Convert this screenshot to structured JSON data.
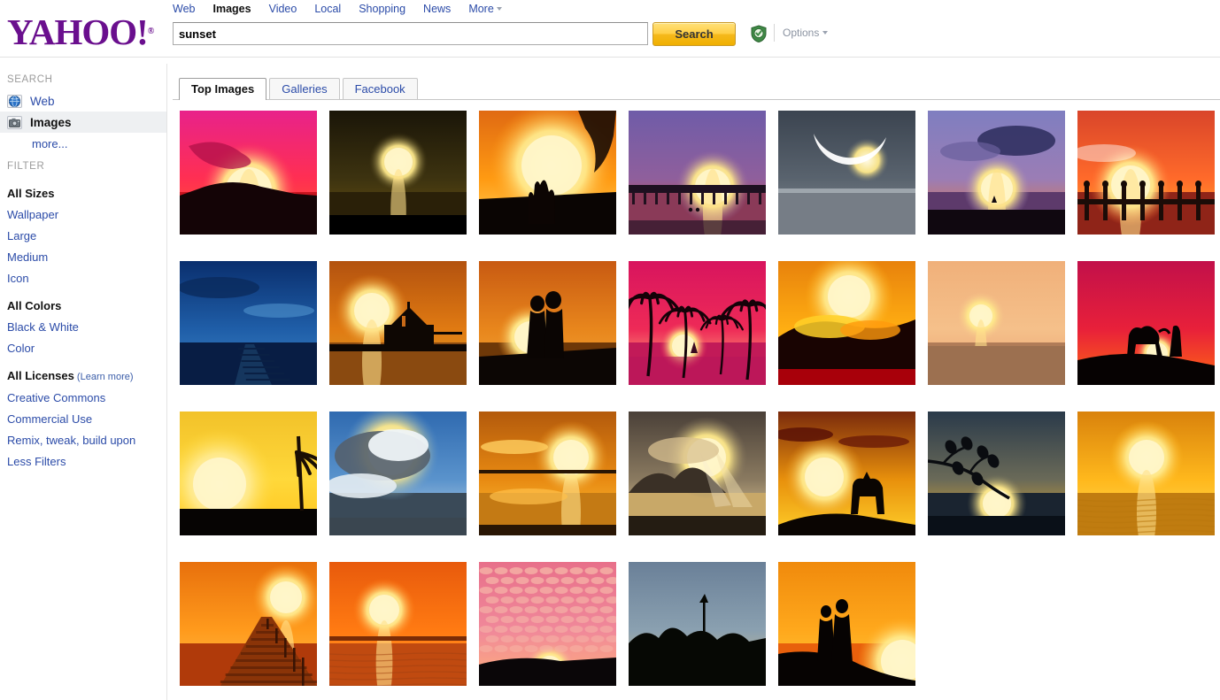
{
  "brand": {
    "logo_text": "YAHOO!",
    "registered": "®"
  },
  "topnav": {
    "items": [
      {
        "label": "Web",
        "active": false
      },
      {
        "label": "Images",
        "active": true
      },
      {
        "label": "Video",
        "active": false
      },
      {
        "label": "Local",
        "active": false
      },
      {
        "label": "Shopping",
        "active": false
      },
      {
        "label": "News",
        "active": false
      },
      {
        "label": "More",
        "active": false
      }
    ]
  },
  "search": {
    "query": "sunset",
    "placeholder": "",
    "button_label": "Search",
    "options_label": "Options",
    "shield_icon": "shield-check-icon",
    "button_color": "#f5b91c"
  },
  "sidebar": {
    "search_heading": "SEARCH",
    "search_items": [
      {
        "label": "Web",
        "icon": "globe-icon",
        "selected": false
      },
      {
        "label": "Images",
        "icon": "camera-icon",
        "selected": true
      }
    ],
    "more_label": "more...",
    "filter_heading": "FILTER",
    "filters": [
      {
        "label": "All Sizes",
        "bold": true
      },
      {
        "label": "Wallpaper",
        "bold": false
      },
      {
        "label": "Large",
        "bold": false
      },
      {
        "label": "Medium",
        "bold": false
      },
      {
        "label": "Icon",
        "bold": false
      },
      {
        "label": "All Colors",
        "bold": true
      },
      {
        "label": "Black & White",
        "bold": false
      },
      {
        "label": "Color",
        "bold": false
      },
      {
        "label": "All Licenses",
        "bold": true,
        "extra": "(Learn more)"
      },
      {
        "label": "Creative Commons",
        "bold": false
      },
      {
        "label": "Commercial Use",
        "bold": false
      },
      {
        "label": "Remix, tweak, build upon",
        "bold": false
      },
      {
        "label": "Less Filters",
        "bold": false
      }
    ]
  },
  "tabs": [
    {
      "label": "Top Images",
      "active": true
    },
    {
      "label": "Galleries",
      "active": false
    },
    {
      "label": "Facebook",
      "active": false
    }
  ],
  "results": {
    "count": 28,
    "thumbnails": [
      {
        "name": "pink-sky-hill-lake-sunset",
        "sky_top": "#e8228a",
        "sky_mid": "#ff2f52",
        "sky_low": "#ff5a2a",
        "water": "#c8141f",
        "land": "#140406",
        "style": "hill"
      },
      {
        "name": "dark-moon-over-sea",
        "sky_top": "#1a1508",
        "sky_mid": "#3d3310",
        "sky_low": "#6d5510",
        "water": "#2a2008",
        "land": "#000000",
        "style": "moon"
      },
      {
        "name": "orange-sunset-hand-silhouette",
        "sky_top": "#e06a12",
        "sky_mid": "#ff9a12",
        "sky_low": "#ffd35e",
        "water": "#140a02",
        "land": "#0a0503",
        "style": "hand"
      },
      {
        "name": "purple-pier-beach-sunset",
        "sky_top": "#6f5ca8",
        "sky_mid": "#8f5f9c",
        "sky_low": "#e8452c",
        "water": "#8a3a58",
        "land": "#241327",
        "style": "pier"
      },
      {
        "name": "crescent-moon-over-water",
        "sky_top": "#3b4450",
        "sky_mid": "#59636e",
        "sky_low": "#8a9099",
        "water": "#767d86",
        "land": "#9aa0a6",
        "style": "crescent"
      },
      {
        "name": "purple-clouds-beach-bird",
        "sky_top": "#7f7ec0",
        "sky_mid": "#9b7db5",
        "sky_low": "#f0732a",
        "water": "#5d3a6b",
        "land": "#100810",
        "style": "clouds"
      },
      {
        "name": "red-sky-dock-birds",
        "sky_top": "#d9452a",
        "sky_mid": "#ff6a2a",
        "sky_low": "#ffb32a",
        "water": "#8f2418",
        "land": "#1a0a08",
        "style": "dock"
      },
      {
        "name": "blue-night-boardwalk",
        "sky_top": "#0a2f6e",
        "sky_mid": "#1f5ea8",
        "sky_low": "#3f86c8",
        "water": "#081d44",
        "land": "#03102a",
        "style": "boardwalk"
      },
      {
        "name": "gazebo-pier-orange-sun",
        "sky_top": "#b3520f",
        "sky_mid": "#e07a12",
        "sky_low": "#d9a02a",
        "water": "#8a4a10",
        "land": "#120804",
        "style": "gazebo"
      },
      {
        "name": "couple-embracing-silhouette",
        "sky_top": "#c85a12",
        "sky_mid": "#e8861c",
        "sky_low": "#f2a83a",
        "water": "#6e3808",
        "land": "#0c0604",
        "style": "couple"
      },
      {
        "name": "palm-trees-magenta-sunset",
        "sky_top": "#d8145e",
        "sky_mid": "#ee2a57",
        "sky_low": "#ffd08a",
        "water": "#c21a58",
        "land": "#6a0a34",
        "style": "palms"
      },
      {
        "name": "fiery-orange-clouds",
        "sky_top": "#e8820c",
        "sky_mid": "#ffae12",
        "sky_low": "#ffd028",
        "water": "#b3000a",
        "land": "#160400",
        "style": "fire"
      },
      {
        "name": "golden-sky-ocean-horizon",
        "sky_top": "#f0b07a",
        "sky_mid": "#f5c08a",
        "sky_low": "#e8a070",
        "water": "#b07c58",
        "land": "#8a6040",
        "style": "softsun"
      },
      {
        "name": "camel-and-person-silhouette",
        "sky_top": "#c2104a",
        "sky_mid": "#e8203a",
        "sky_low": "#ff6a12",
        "water": "#2a0206",
        "land": "#0a0202",
        "style": "camel"
      },
      {
        "name": "big-yellow-sun-palm-leaf",
        "sky_top": "#f2c22a",
        "sky_mid": "#ffd83a",
        "sky_low": "#ffc41c",
        "water": "#0a0604",
        "land": "#060403",
        "style": "bigsun"
      },
      {
        "name": "blue-sky-storm-clouds",
        "sky_top": "#2f6ab0",
        "sky_mid": "#5a93cc",
        "sky_low": "#c8d8e6",
        "water": "#3a4a58",
        "land": "#2a3540",
        "style": "stormy"
      },
      {
        "name": "golden-sun-reflection-sea",
        "sky_top": "#b35a0c",
        "sky_mid": "#e88a12",
        "sky_low": "#ffc83a",
        "water": "#c47a14",
        "land": "#3a1c04",
        "style": "goldref"
      },
      {
        "name": "sun-rays-over-mountain",
        "sky_top": "#4a4038",
        "sky_mid": "#8a7a60",
        "sky_low": "#f0d8a0",
        "water": "#c8a868",
        "land": "#2a2018",
        "style": "rays"
      },
      {
        "name": "wolf-silhouette-on-ridge",
        "sky_top": "#7a2a0c",
        "sky_mid": "#e8900c",
        "sky_low": "#ffcf2a",
        "water": "#c87a0c",
        "land": "#0a0502",
        "style": "wolf"
      },
      {
        "name": "tree-branch-silhouette-sea",
        "sky_top": "#2a3a4a",
        "sky_mid": "#6a6a58",
        "sky_low": "#f0b02a",
        "water": "#1a2430",
        "land": "#080c12",
        "style": "branch"
      },
      {
        "name": "golden-sea-sunset-waves",
        "sky_top": "#d9820c",
        "sky_mid": "#ffb81c",
        "sky_low": "#ffdd5a",
        "water": "#c07c10",
        "land": "#6a3c06",
        "style": "waves"
      },
      {
        "name": "wooden-pier-walkway-sunset",
        "sky_top": "#e8700c",
        "sky_mid": "#ff9a1c",
        "sky_low": "#ffc04a",
        "water": "#b03a0a",
        "land": "#7a2a06",
        "style": "walkway"
      },
      {
        "name": "orange-sun-over-calm-sea",
        "sky_top": "#e85a0c",
        "sky_mid": "#ff7a12",
        "sky_low": "#ff9a28",
        "water": "#c04a10",
        "land": "#5a1c04",
        "style": "calmsea"
      },
      {
        "name": "pink-mackerel-clouds",
        "sky_top": "#e8708a",
        "sky_mid": "#f0889a",
        "sky_low": "#ffb07a",
        "water": "#3a1a2a",
        "land": "#0a0608",
        "style": "mackerel"
      },
      {
        "name": "tree-line-dusk-tower",
        "sky_top": "#6a8098",
        "sky_mid": "#8aa0b0",
        "sky_low": "#d8c090",
        "water": "#0a0c08",
        "land": "#060804",
        "style": "treeline"
      },
      {
        "name": "two-people-on-cliff-silhouette",
        "sky_top": "#f08a0c",
        "sky_mid": "#ffa81c",
        "sky_low": "#ffc83a",
        "water": "#e8600c",
        "land": "#060302",
        "style": "cliff"
      }
    ]
  }
}
